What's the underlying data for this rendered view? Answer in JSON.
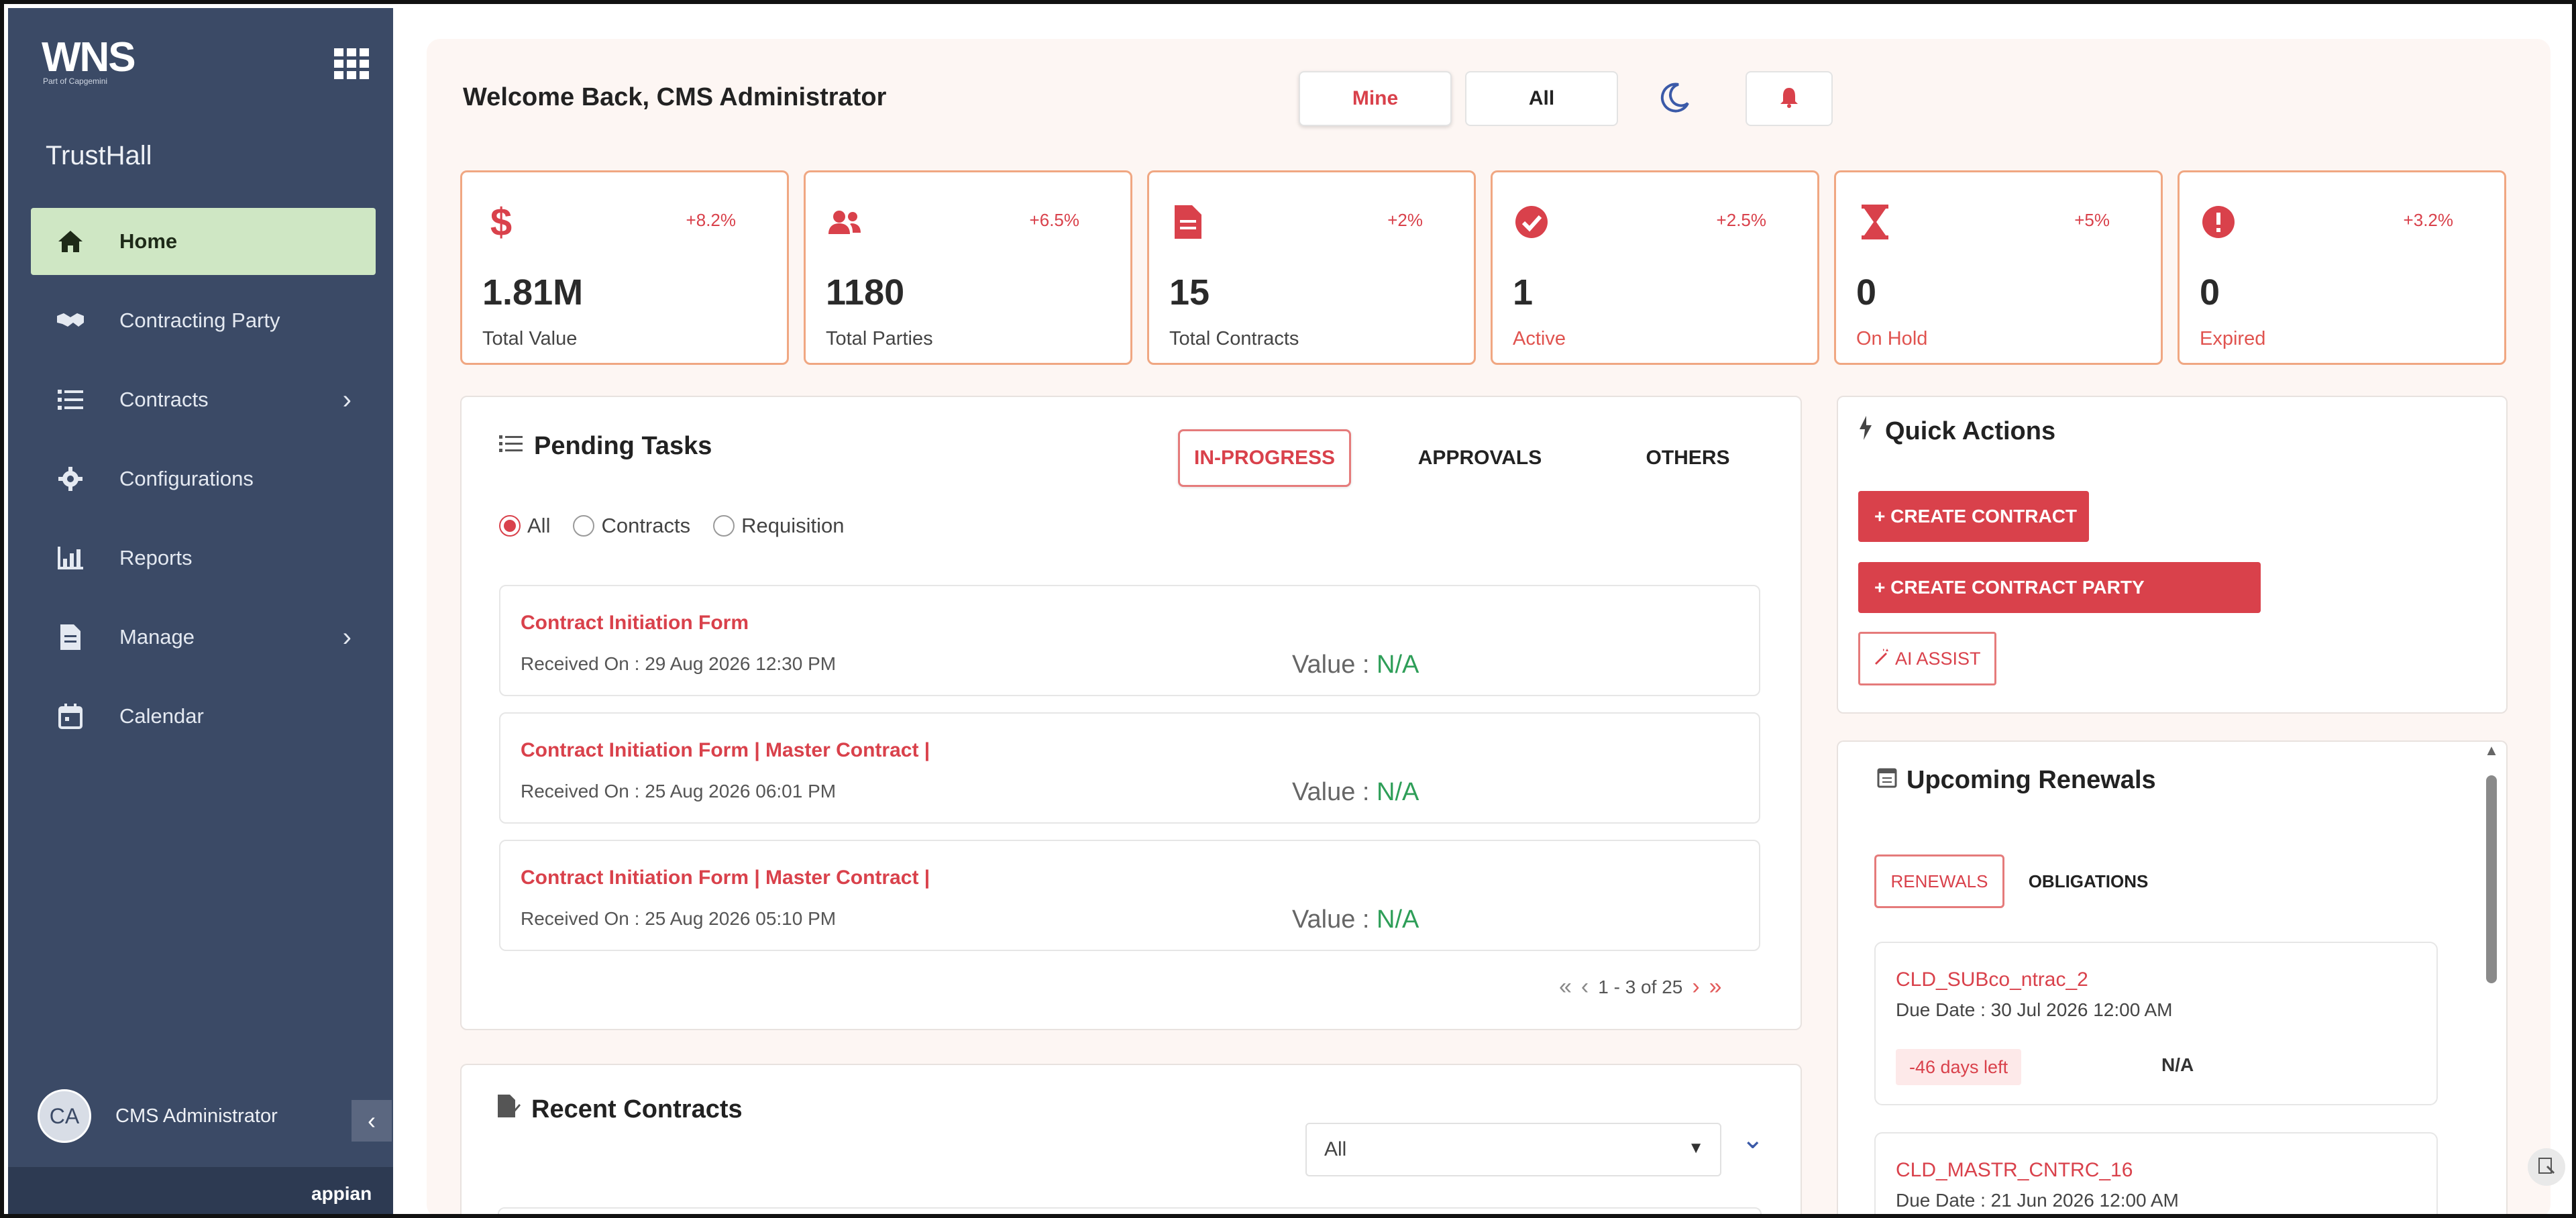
{
  "sidebar": {
    "logo": "WNS",
    "logo_tagline": "Part of Capgemini",
    "app_name": "TrustHall",
    "items": [
      {
        "label": "Home",
        "icon": "home-icon",
        "active": true
      },
      {
        "label": "Contracting Party",
        "icon": "handshake-icon"
      },
      {
        "label": "Contracts",
        "icon": "list-icon",
        "has_children": true
      },
      {
        "label": "Configurations",
        "icon": "gear-icon"
      },
      {
        "label": "Reports",
        "icon": "bar-chart-icon"
      },
      {
        "label": "Manage",
        "icon": "document-icon",
        "has_children": true
      },
      {
        "label": "Calendar",
        "icon": "calendar-icon"
      }
    ],
    "user": {
      "initials": "CA",
      "name": "CMS Administrator"
    },
    "collapse_icon": "chevron-left-icon",
    "footer": "appian"
  },
  "header": {
    "welcome": "Welcome Back, CMS Administrator",
    "toggle_mine": "Mine",
    "toggle_all": "All"
  },
  "kpis": [
    {
      "icon": "dollar-icon",
      "delta": "+8.2%",
      "value": "1.81M",
      "label": "Total Value",
      "label_color": "normal"
    },
    {
      "icon": "users-icon",
      "delta": "+6.5%",
      "value": "1180",
      "label": "Total Parties",
      "label_color": "normal"
    },
    {
      "icon": "file-icon",
      "delta": "+2%",
      "value": "15",
      "label": "Total Contracts",
      "label_color": "normal"
    },
    {
      "icon": "check-circle-icon",
      "delta": "+2.5%",
      "value": "1",
      "label": "Active",
      "label_color": "red"
    },
    {
      "icon": "hourglass-icon",
      "delta": "+5%",
      "value": "0",
      "label": "On Hold",
      "label_color": "red"
    },
    {
      "icon": "alert-circle-icon",
      "delta": "+3.2%",
      "value": "0",
      "label": "Expired",
      "label_color": "red"
    }
  ],
  "pending": {
    "title": "Pending Tasks",
    "tabs": [
      "IN-PROGRESS",
      "APPROVALS",
      "OTHERS"
    ],
    "filters": [
      "All",
      "Contracts",
      "Requisition"
    ],
    "value_label": "Value : ",
    "tasks": [
      {
        "title": "Contract Initiation Form",
        "received": "Received On : 29 Aug 2026 12:30 PM",
        "value": "N/A"
      },
      {
        "title": "Contract Initiation Form | Master Contract |",
        "received": "Received On : 25 Aug 2026 06:01 PM",
        "value": "N/A"
      },
      {
        "title": "Contract Initiation Form | Master Contract |",
        "received": "Received On : 25 Aug 2026 05:10 PM",
        "value": "N/A"
      }
    ],
    "pager": "1 - 3 of 25"
  },
  "quick_actions": {
    "title": "Quick Actions",
    "create_contract": "+ CREATE CONTRACT",
    "create_party": "+ CREATE CONTRACT PARTY",
    "ai_assist": "AI ASSIST"
  },
  "renewals": {
    "title": "Upcoming Renewals",
    "tabs": [
      "RENEWALS",
      "OBLIGATIONS"
    ],
    "items": [
      {
        "name": "CLD_SUBco_ntrac_2",
        "due": "Due Date : 30 Jul 2026 12:00 AM",
        "days": "-46 days left",
        "value": "N/A"
      },
      {
        "name": "CLD_MASTR_CNTRC_16",
        "due": "Due Date : 21 Jun 2026 12:00 AM"
      }
    ]
  },
  "recent": {
    "title": "Recent Contracts",
    "filter_value": "All"
  },
  "colors": {
    "sidebar": "#3b4a66",
    "accent": "#d9414b",
    "active_nav": "#cfe7c4",
    "success": "#2e9e58",
    "kpi_border": "#f0a782"
  }
}
